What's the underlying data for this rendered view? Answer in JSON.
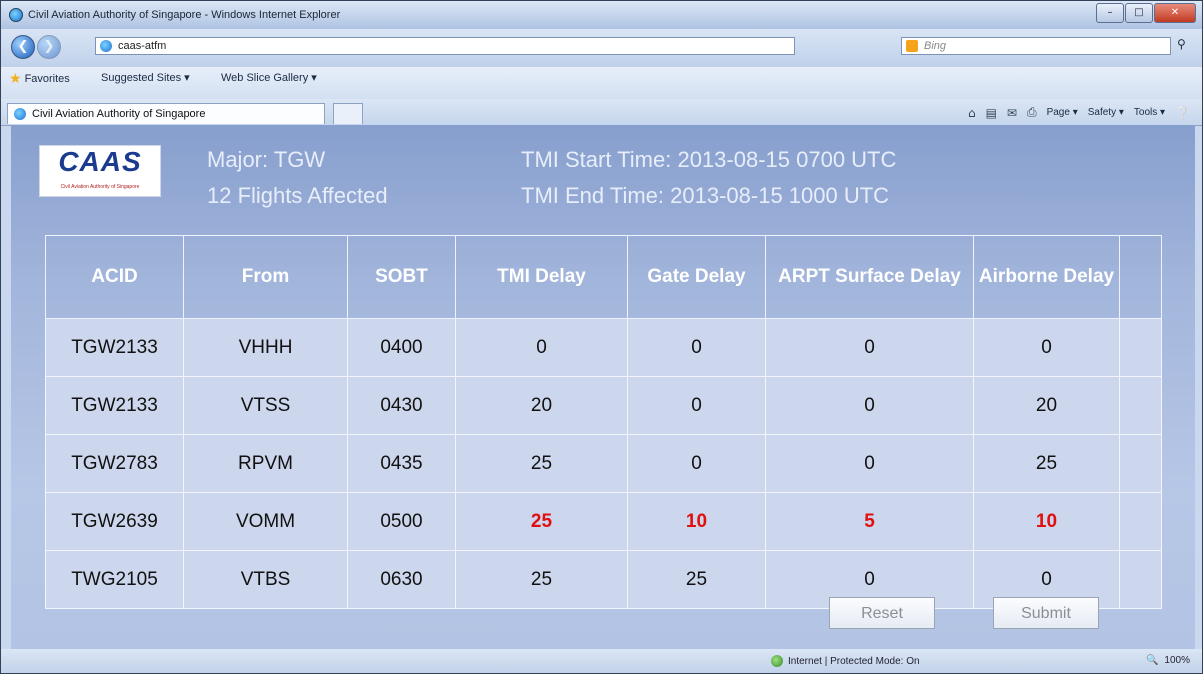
{
  "window": {
    "title": "Civil Aviation Authority of Singapore - Windows Internet Explorer"
  },
  "address": {
    "url": "caas-atfm",
    "search_placeholder": "Bing"
  },
  "favorites": {
    "label": "Favorites",
    "items": [
      "Suggested Sites ▾",
      "Web Slice Gallery ▾"
    ]
  },
  "tab": {
    "title": "Civil Aviation Authority of Singapore"
  },
  "commandbar": {
    "page": "Page ▾",
    "safety": "Safety ▾",
    "tools": "Tools ▾"
  },
  "logo": {
    "text": "CAAS",
    "subtitle": "Civil Aviation Authority of Singapore"
  },
  "header": {
    "major": "Major:  TGW",
    "flights": "12 Flights Affected",
    "start": "TMI Start Time:  2013-08-15  0700 UTC",
    "end": "TMI End Time:   2013-08-15  1000 UTC"
  },
  "table": {
    "columns": [
      "ACID",
      "From",
      "SOBT",
      "TMI Delay",
      "Gate Delay",
      "ARPT Surface Delay",
      "Airborne Delay"
    ],
    "rows": [
      [
        "TGW2133",
        "VHHH",
        "0400",
        "0",
        "0",
        "0",
        "0"
      ],
      [
        "TGW2133",
        "VTSS",
        "0430",
        "20",
        "0",
        "0",
        "20"
      ],
      [
        "TGW2783",
        "RPVM",
        "0435",
        "25",
        "0",
        "0",
        "25"
      ],
      [
        "TGW2639",
        "VOMM",
        "0500",
        "25",
        "10",
        "5",
        "10"
      ],
      [
        "TWG2105",
        "VTBS",
        "0630",
        "25",
        "25",
        "0",
        "0"
      ]
    ],
    "highlight_row": 3,
    "highlight_color": "#e01010"
  },
  "buttons": {
    "reset": "Reset",
    "submit": "Submit"
  },
  "status": {
    "zone": "Internet | Protected Mode: On",
    "zoom": "  100%"
  }
}
